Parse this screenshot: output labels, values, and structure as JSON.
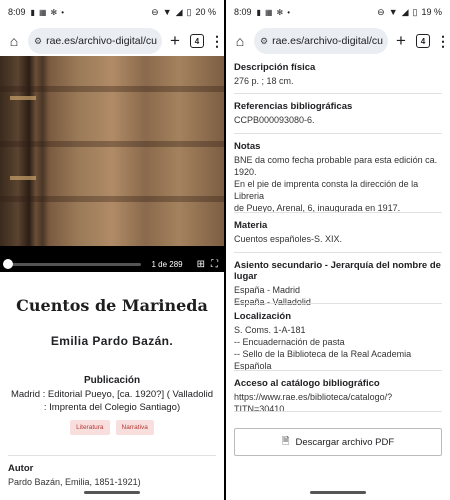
{
  "left": {
    "status": {
      "time": "8:09",
      "battery": "20 %"
    },
    "browser": {
      "url": "rae.es/archivo-digital/cu",
      "tab_count": "4"
    },
    "viewer": {
      "pager": "1 de 289"
    },
    "book": {
      "title": "Cuentos de Marineda",
      "author": "Emilia Pardo Bazán.",
      "publication_label": "Publicación",
      "publication_value": "Madrid : Editorial Pueyo, [ca. 1920?] ( Valladolid : Imprenta del Colegio Santiago)",
      "tags": [
        "Literatura",
        "Narrativa"
      ],
      "autor_label": "Autor",
      "autor_value": "Pardo Bazán, Emilia, 1851-1921)"
    }
  },
  "right": {
    "status": {
      "time": "8:09",
      "battery": "19 %"
    },
    "browser": {
      "url": "rae.es/archivo-digital/cu",
      "tab_count": "4"
    },
    "sections": [
      {
        "label": "Descripción física",
        "lines": [
          "276 p. ; 18 cm."
        ]
      },
      {
        "label": "Referencias bibliográficas",
        "lines": [
          "CCPB000093080-6."
        ]
      },
      {
        "label": "Notas",
        "lines": [
          "BNE da como fecha probable para esta edición ca.",
          "1920.",
          "En el pie de imprenta consta la dirección de la Libreria",
          "de Pueyo, Arenal, 6, inaugurada en 1917."
        ]
      },
      {
        "label": "Materia",
        "lines": [
          "Cuentos españoles-S. XIX."
        ]
      },
      {
        "label": "Asiento secundario - Jerarquía del nombre de lugar",
        "lines": [
          "España - Madrid",
          "España - Valladolid"
        ]
      },
      {
        "label": "Localización",
        "lines": [
          "S. Coms. 1-A-181",
          "-- Encuadernación de pasta",
          "-- Sello de la Biblioteca de la Real Academia Española"
        ]
      },
      {
        "label": "Acceso al catálogo bibliográfico",
        "lines": [
          "https://www.rae.es/biblioteca/catalogo/?TITN=30410"
        ]
      }
    ],
    "download_label": "Descargar archivo PDF"
  },
  "icons": [
    "home-icon",
    "site-info-icon",
    "new-tab-icon",
    "tabs-icon",
    "menu-icon",
    "grid-icon",
    "fullscreen-icon",
    "pdf-icon"
  ]
}
